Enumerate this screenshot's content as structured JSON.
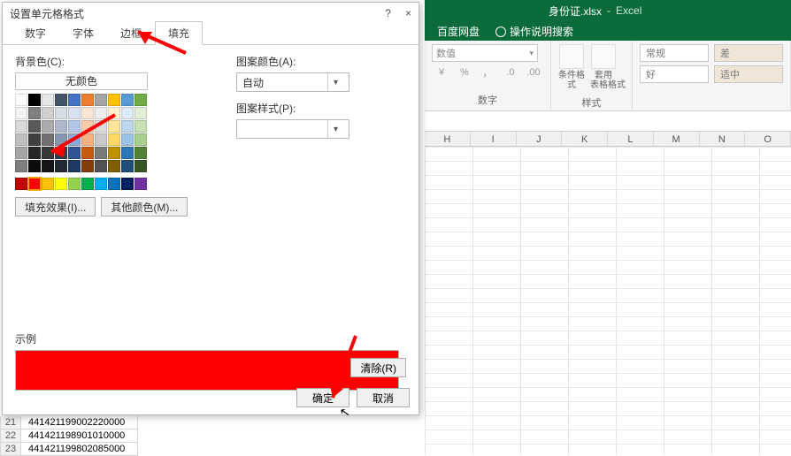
{
  "app": {
    "filename": "身份证.xlsx",
    "suffix": "Excel"
  },
  "helpbar": {
    "baidu": "百度网盘",
    "tellme": "操作说明搜索"
  },
  "ribbon": {
    "number": {
      "label": "数字",
      "combo": "数值",
      "b1": "%",
      "b2": "，",
      "b3": ".0",
      "b4": ".00"
    },
    "styles": {
      "label": "样式",
      "cf": "条件格式",
      "tbl": "套用\n表格格式",
      "c1": "常规",
      "c2": "差",
      "c3": "好",
      "c4": "适中"
    }
  },
  "columns": [
    "H",
    "I",
    "J",
    "K",
    "L",
    "M",
    "N",
    "O"
  ],
  "rows": [
    {
      "n": "21",
      "v": "441421199002220000"
    },
    {
      "n": "22",
      "v": "441421198901010000"
    },
    {
      "n": "23",
      "v": "441421199802085000"
    }
  ],
  "dialog": {
    "title": "设置单元格格式",
    "help": "?",
    "close": "×",
    "tabs": {
      "t1": "数字",
      "t2": "字体",
      "t3": "边框",
      "t4": "填充"
    },
    "bg_label": "背景色(C):",
    "no_color": "无颜色",
    "pattern_color_label": "图案颜色(A):",
    "pattern_color_value": "自动",
    "pattern_style_label": "图案样式(P):",
    "fill_effects": "填充效果(I)...",
    "other_colors": "其他颜色(M)...",
    "sample": "示例",
    "clear": "清除(R)",
    "ok": "确定",
    "cancel": "取消"
  },
  "palette": {
    "theme": [
      [
        "#ffffff",
        "#000000",
        "#e7e6e6",
        "#44546a",
        "#4472c4",
        "#ed7d31",
        "#a5a5a5",
        "#ffc000",
        "#5b9bd5",
        "#70ad47"
      ],
      [
        "#f2f2f2",
        "#7f7f7f",
        "#d0cece",
        "#d6dce4",
        "#d9e2f3",
        "#fbe5d5",
        "#ededed",
        "#fff2cc",
        "#deebf6",
        "#e2efd9"
      ],
      [
        "#d8d8d8",
        "#595959",
        "#aeabab",
        "#adb9ca",
        "#b4c6e7",
        "#f7cbac",
        "#dbdbdb",
        "#fee599",
        "#bdd7ee",
        "#c5e0b3"
      ],
      [
        "#bfbfbf",
        "#3f3f3f",
        "#757070",
        "#8496b0",
        "#8eaadb",
        "#f4b183",
        "#c9c9c9",
        "#ffd965",
        "#9cc3e5",
        "#a8d08d"
      ],
      [
        "#a5a5a5",
        "#262626",
        "#3a3838",
        "#323f4f",
        "#2f5496",
        "#c55a11",
        "#7b7b7b",
        "#bf9000",
        "#2e75b5",
        "#538135"
      ],
      [
        "#7f7f7f",
        "#0c0c0c",
        "#171616",
        "#222a35",
        "#1f3864",
        "#833c0b",
        "#525252",
        "#7f6000",
        "#1e4e79",
        "#375623"
      ]
    ],
    "standard": [
      "#c00000",
      "#ff0000",
      "#ffc000",
      "#ffff00",
      "#92d050",
      "#00b050",
      "#00b0f0",
      "#0070c0",
      "#002060",
      "#7030a0"
    ]
  },
  "chart_data": null
}
